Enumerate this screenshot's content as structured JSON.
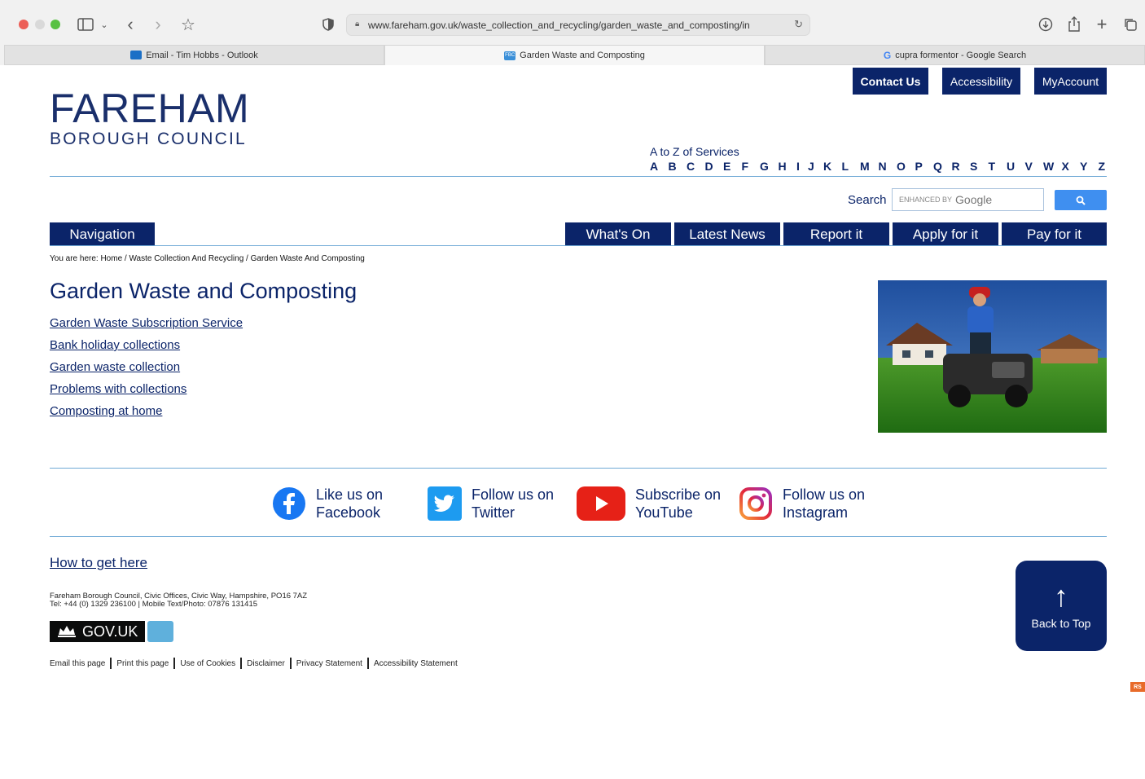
{
  "browser": {
    "url": "www.fareham.gov.uk/waste_collection_and_recycling/garden_waste_and_composting/in",
    "tabs": [
      {
        "label": "Email - Tim Hobbs - Outlook",
        "active": false
      },
      {
        "label": "Garden Waste and Composting",
        "active": true,
        "favicon_text": "FBC"
      },
      {
        "label": "cupra formentor - Google Search",
        "active": false
      }
    ]
  },
  "header": {
    "logo_line1": "FAREHAM",
    "logo_line2": "BOROUGH COUNCIL",
    "buttons": {
      "contact": "Contact Us",
      "accessibility": "Accessibility",
      "myaccount": "MyAccount"
    },
    "az_label": "A to Z of Services",
    "az_letters": [
      "A",
      "B",
      "C",
      "D",
      "E",
      "F",
      "G",
      "H",
      "I",
      "J",
      "K",
      "L",
      "M",
      "N",
      "O",
      "P",
      "Q",
      "R",
      "S",
      "T",
      "U",
      "V",
      "W",
      "X",
      "Y",
      "Z"
    ],
    "search_label": "Search",
    "search_placeholder_small": "ENHANCED BY",
    "search_placeholder_brand": "Google"
  },
  "nav": {
    "navigation": "Navigation",
    "whats_on": "What's On",
    "latest_news": "Latest News",
    "report_it": "Report it",
    "apply_for_it": "Apply for it",
    "pay_for_it": "Pay for it"
  },
  "breadcrumb": "You are here: Home / Waste Collection And Recycling / Garden Waste And Composting",
  "main": {
    "title": "Garden Waste and Composting",
    "links": [
      "Garden Waste Subscription Service",
      "Bank holiday collections",
      "Garden waste collection",
      "Problems with collections",
      "Composting at home"
    ]
  },
  "social": {
    "facebook": {
      "line1": "Like us on",
      "line2": "Facebook"
    },
    "twitter": {
      "line1": "Follow us on",
      "line2": "Twitter"
    },
    "youtube": {
      "line1": "Subscribe on",
      "line2": "YouTube"
    },
    "instagram": {
      "line1": "Follow us on",
      "line2": "Instagram"
    }
  },
  "footer": {
    "how_to_get_here": "How to get here",
    "address_line1": "Fareham Borough Council, Civic Offices, Civic Way, Hampshire, PO16 7AZ",
    "address_line2": "Tel: +44 (0) 1329 236100 | Mobile Text/Photo: 07876 131415",
    "govuk": "GOV.UK",
    "links": [
      "Email this page",
      "Print this page",
      "Use of Cookies",
      "Disclaimer",
      "Privacy Statement",
      "Accessibility Statement"
    ],
    "back_to_top": "Back to Top",
    "rs_badge": "RS"
  },
  "colors": {
    "brand": "#0b2469",
    "rule": "#6fa9d6",
    "search_button": "#3f8ff0"
  }
}
